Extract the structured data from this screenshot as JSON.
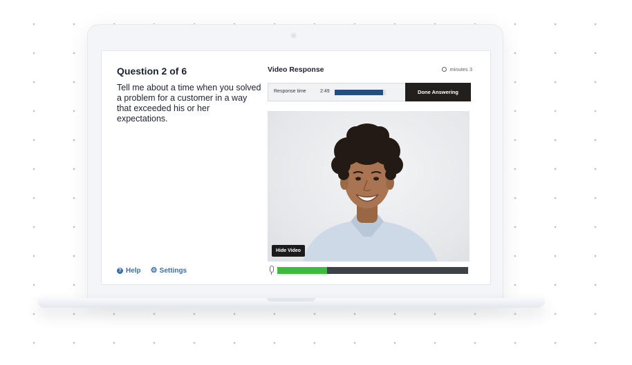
{
  "question": {
    "title": "Question 2 of 6",
    "text": "Tell me about a time when you solved a problem for a customer in a way that exceeded his or her expectations."
  },
  "footer": {
    "help_label": "Help",
    "settings_label": "Settings"
  },
  "panel": {
    "title": "Video Response",
    "time_limit": "minutes 3",
    "response_label": "Response time",
    "response_time": "2:49",
    "response_progress": 0.94,
    "done_label": "Done Answering",
    "hide_video_label": "Hide Video",
    "audio_level": 0.26
  },
  "icons": {
    "help": "help-icon",
    "settings": "gear-icon",
    "clock": "clock-icon",
    "mic": "microphone-icon"
  },
  "colors": {
    "accent": "#3a6fb0",
    "progress": "#244f86",
    "audio": "#3dbb3d",
    "button_dark": "#221f1c"
  }
}
